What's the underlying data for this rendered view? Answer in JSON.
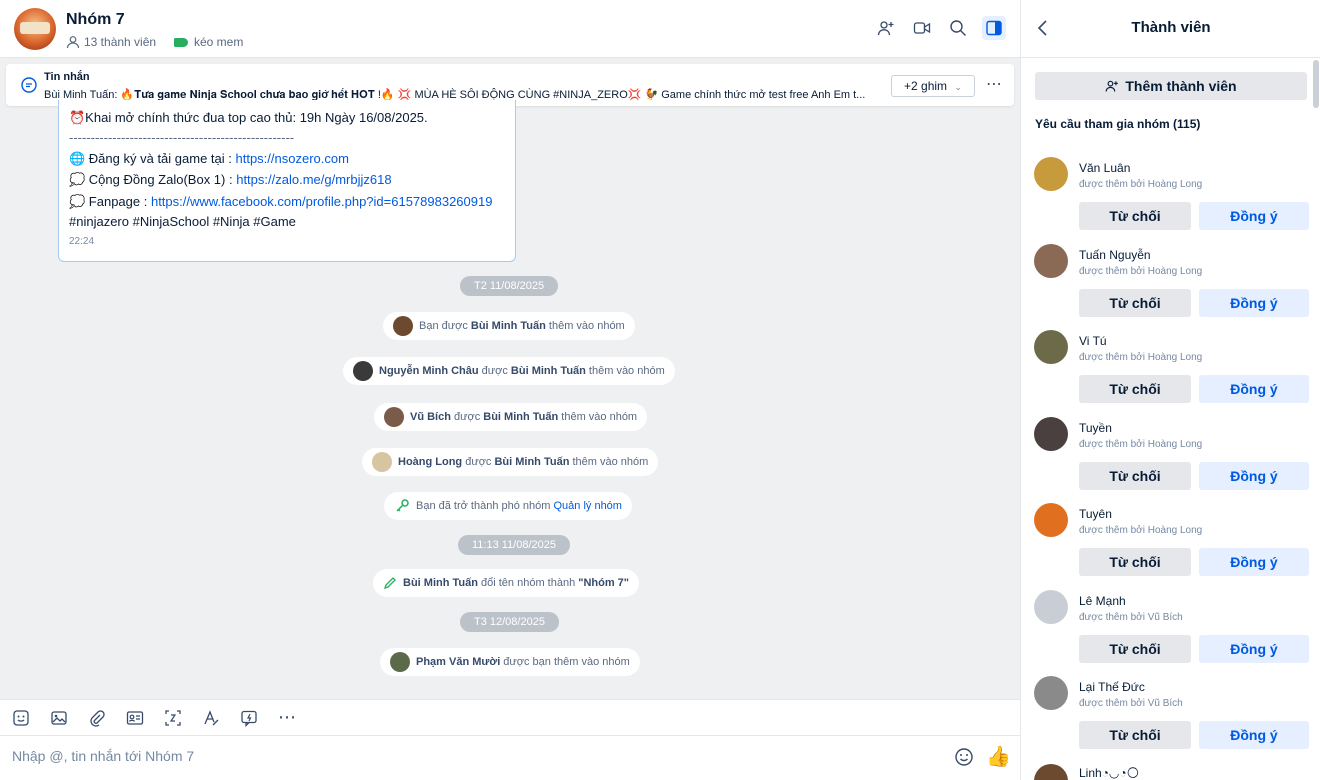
{
  "header": {
    "group_name": "Nhóm 7",
    "member_count": "13 thành viên",
    "tag": "kéo mem",
    "icons": [
      "add-member-icon",
      "video-call-icon",
      "search-icon",
      "sidebar-toggle-icon"
    ]
  },
  "pinned": {
    "title": "Tin nhắn",
    "text": "Bùi Minh Tuấn: 🔥𝐓𝐮̛𝐚 𝐠𝐚𝐦𝐞 𝐍𝐢𝐧𝐣𝐚 𝐒𝐜𝐡𝐨𝐨𝐥 𝐜𝐡𝐮̛𝐚 𝐛𝐚𝐨 𝐠𝐢𝐨̛̀ 𝐡𝐞̂́𝐭 𝐇𝐎𝐓 !🔥 💢 MÙA HÈ SÔI ĐỘNG CÙNG #NINJA_ZERO💢 🐓 Game chính thức mở test free Anh Em t...",
    "ghim_label": "+2 ghim"
  },
  "message": {
    "line1": "⏰Khai mở chính thức đua top cao thủ: 19h Ngày 16/08/2025.",
    "divider": "----------------------------------------------------",
    "reg_label": "🌐 Đăng ký và tải game tại : ",
    "reg_link": "https://nsozero.com",
    "community_label": "💭 Cộng Đồng Zalo(Box 1) : ",
    "community_link": "https://zalo.me/g/mrbjjz618",
    "fanpage_label": "💭 Fanpage : ",
    "fanpage_link": "https://www.facebook.com/profile.php?id=61578983260919",
    "hashtags": "#ninjazero #NinjaSchool #Ninja #Game",
    "time": "22:24"
  },
  "timeline": {
    "date1": "T2 11/08/2025",
    "sys1_pre": "Bạn được ",
    "sys1_actor": "Bùi Minh Tuấn",
    "sys1_post": " thêm vào nhóm",
    "sys2_subject": "Nguyễn Minh Châu",
    "sys2_mid": " được ",
    "sys2_actor": "Bùi Minh Tuấn",
    "sys2_post": " thêm vào nhóm",
    "sys3_subject": "Vũ Bích",
    "sys3_mid": " được ",
    "sys3_actor": "Bùi Minh Tuấn",
    "sys3_post": " thêm vào nhóm",
    "sys4_subject": "Hoàng Long",
    "sys4_mid": " được ",
    "sys4_actor": "Bùi Minh Tuấn",
    "sys4_post": " thêm vào nhóm",
    "sys5_pre": "Bạn đã trở thành phó nhóm ",
    "sys5_link": "Quản lý nhóm",
    "date2": "11:13 11/08/2025",
    "sys6_actor": "Bùi Minh Tuấn",
    "sys6_mid": " đổi tên nhóm thành ",
    "sys6_name": "\"Nhóm 7\"",
    "date3": "T3 12/08/2025",
    "sys7_subject": "Phạm Văn Mười",
    "sys7_post": " được bạn thêm vào nhóm"
  },
  "composer": {
    "placeholder": "Nhập @, tin nhắn tới Nhóm 7",
    "toolbar_icons": [
      "sticker-icon",
      "image-icon",
      "attachment-icon",
      "contact-card-icon",
      "screenshot-icon",
      "text-format-icon",
      "quick-message-icon",
      "more-icon"
    ]
  },
  "panel": {
    "title": "Thành viên",
    "add_member": "Thêm thành viên",
    "requests_title": "Yêu cầu tham gia nhóm (115)",
    "reject_label": "Từ chối",
    "accept_label": "Đồng ý",
    "requests": [
      {
        "name": "Văn Luân",
        "by": "được thêm bởi Hoàng Long",
        "color": "#c79a3c"
      },
      {
        "name": "Tuấn Nguyễn",
        "by": "được thêm bởi Hoàng Long",
        "color": "#8a6a55"
      },
      {
        "name": "Vi Tú",
        "by": "được thêm bởi Hoàng Long",
        "color": "#6d6a4a"
      },
      {
        "name": "Tuyền",
        "by": "được thêm bởi Hoàng Long",
        "color": "#4a4040"
      },
      {
        "name": "Tuyên",
        "by": "được thêm bởi Hoàng Long",
        "color": "#e07020"
      },
      {
        "name": "Lê Mạnh",
        "by": "được thêm bởi Vũ Bích",
        "color": "#c9ced6"
      },
      {
        "name": "Lại Thế Đức",
        "by": "được thêm bởi Vũ Bích",
        "color": "#8a8a8a"
      }
    ],
    "partial_name": "Linh◔◡◔🌕"
  }
}
